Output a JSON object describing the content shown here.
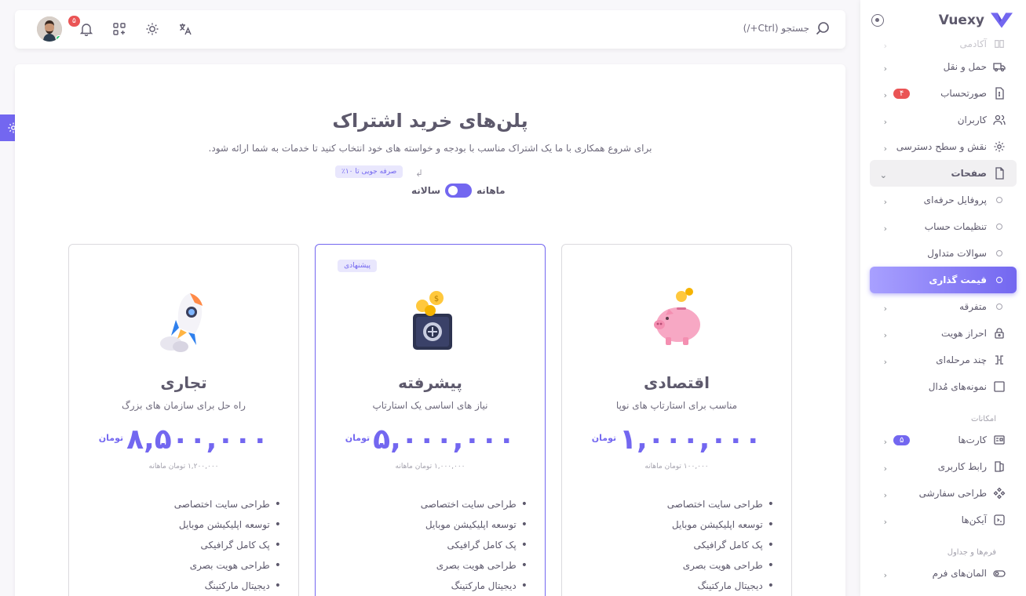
{
  "brand": {
    "name": "Vuexy"
  },
  "search": {
    "placeholder": "جستجو (Ctrl+/)"
  },
  "notifications": {
    "count": "۵"
  },
  "sidebar": {
    "items": [
      {
        "label": "آکادمی",
        "icon": "book-icon"
      },
      {
        "label": "حمل و نقل",
        "icon": "truck-icon"
      },
      {
        "label": "صورتحساب",
        "icon": "invoice-icon",
        "badge": "۴"
      },
      {
        "label": "کاربران",
        "icon": "users-icon"
      },
      {
        "label": "نقش و سطح دسترسی",
        "icon": "settings-icon"
      },
      {
        "label": "صفحات",
        "icon": "file-icon"
      },
      {
        "label": "پروفایل حرفه‌ای"
      },
      {
        "label": "تنظیمات حساب"
      },
      {
        "label": "سوالات متداول"
      },
      {
        "label": "قیمت گذاری"
      },
      {
        "label": "متفرقه"
      },
      {
        "label": "احراز هویت",
        "icon": "lock-icon"
      },
      {
        "label": "چند مرحله‌ای",
        "icon": "stepper-icon"
      },
      {
        "label": "نمونه‌های مُدال",
        "icon": "square-icon"
      }
    ],
    "section_features": "امکانات",
    "features": [
      {
        "label": "کارت‌ها",
        "icon": "card-icon",
        "badge": "۵"
      },
      {
        "label": "رابط کاربری",
        "icon": "ui-icon"
      },
      {
        "label": "طراحی سفارشی",
        "icon": "components-icon"
      },
      {
        "label": "آیکن‌ها",
        "icon": "icons-icon"
      }
    ],
    "section_forms": "فرم‌ها و جداول",
    "forms": [
      {
        "label": "المان‌های فرم",
        "icon": "toggle-icon"
      }
    ]
  },
  "pricing": {
    "title": "پلن‌های خرید اشتراک",
    "subtitle": "برای شروع همکاری با ما یک اشتراک مناسب با بودجه و خواسته های خود انتخاب کنید تا خدمات به شما ارائه شود.",
    "save_badge": "صرفه جویی تا ۱۰٪",
    "monthly_label": "ماهانه",
    "yearly_label": "سالانه",
    "plans": [
      {
        "name": "اقتصادی",
        "description": "مناسب برای استارتاپ های نوپا",
        "price": "۱,۰۰۰,۰۰۰",
        "currency": "تومان",
        "yearly_note": "۱۰۰,۰۰۰ تومان ماهانه",
        "features": [
          "طراحی سایت اختصاصی",
          "توسعه اپلیکیشن موبایل",
          "پک کامل گرافیکی",
          "طراحی هویت بصری",
          "دیجیتال مارکتینگ"
        ]
      },
      {
        "name": "پیشرفته",
        "badge": "پیشنهادی",
        "description": "نیاز های اساسی یک استارتاپ",
        "price": "۵,۰۰۰,۰۰۰",
        "currency": "تومان",
        "yearly_note": "۱,۰۰۰,۰۰۰ تومان ماهانه",
        "features": [
          "طراحی سایت اختصاصی",
          "توسعه اپلیکیشن موبایل",
          "پک کامل گرافیکی",
          "طراحی هویت بصری",
          "دیجیتال مارکتینگ"
        ]
      },
      {
        "name": "تجاری",
        "description": "راه حل برای سازمان های بزرگ",
        "price": "۸,۵۰۰,۰۰۰",
        "currency": "تومان",
        "yearly_note": "۱,۲۰۰,۰۰۰ تومان ماهانه",
        "features": [
          "طراحی سایت اختصاصی",
          "توسعه اپلیکیشن موبایل",
          "پک کامل گرافیکی",
          "طراحی هویت بصری",
          "دیجیتال مارکتینگ"
        ]
      }
    ]
  },
  "colors": {
    "primary": "#7367f0",
    "danger": "#ea5455",
    "success": "#28c76f"
  }
}
